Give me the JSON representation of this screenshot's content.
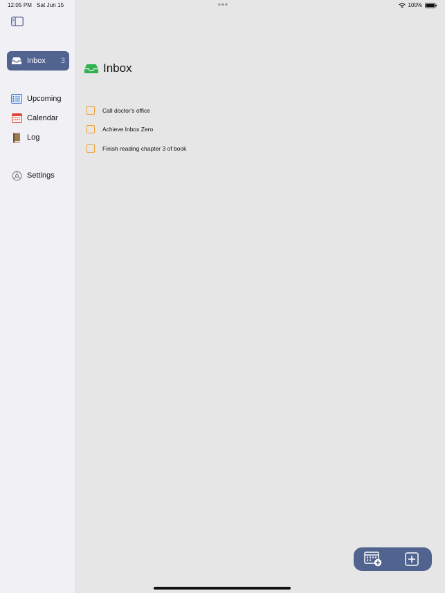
{
  "status": {
    "time": "12:05 PM",
    "date": "Sat Jun 15",
    "battery": "100%"
  },
  "sidebar": {
    "items": [
      {
        "label": "Inbox",
        "count": "3",
        "icon": "inbox-tray-icon"
      },
      {
        "label": "Upcoming",
        "icon": "upcoming-list-icon"
      },
      {
        "label": "Calendar",
        "icon": "calendar-icon"
      },
      {
        "label": "Log",
        "icon": "book-icon"
      },
      {
        "label": "Settings",
        "icon": "gear-icon"
      }
    ]
  },
  "main": {
    "title": "Inbox",
    "tasks": [
      {
        "label": "Call doctor's office"
      },
      {
        "label": "Achieve Inbox Zero"
      },
      {
        "label": "Finish reading chapter 3 of book"
      }
    ]
  },
  "colors": {
    "accent": "#51638f",
    "inbox_green": "#2fb24f",
    "checkbox": "#f0a030",
    "calendar_red": "#e0453a"
  }
}
